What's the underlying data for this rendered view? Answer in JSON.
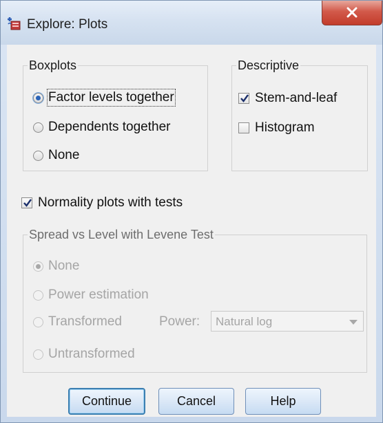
{
  "window": {
    "title": "Explore: Plots"
  },
  "boxplots": {
    "legend": "Boxplots",
    "options": [
      {
        "label": "Factor levels together",
        "selected": true
      },
      {
        "label": "Dependents together",
        "selected": false
      },
      {
        "label": "None",
        "selected": false
      }
    ]
  },
  "descriptive": {
    "legend": "Descriptive",
    "options": [
      {
        "label": "Stem-and-leaf",
        "checked": true
      },
      {
        "label": "Histogram",
        "checked": false
      }
    ]
  },
  "normality": {
    "label": "Normality plots with tests",
    "checked": true
  },
  "spread": {
    "legend": "Spread vs Level with Levene Test",
    "options": [
      {
        "label": "None",
        "selected": true
      },
      {
        "label": "Power estimation",
        "selected": false
      },
      {
        "label": "Transformed",
        "selected": false
      },
      {
        "label": "Untransformed",
        "selected": false
      }
    ],
    "power_label": "Power:",
    "power_value": "Natural log"
  },
  "buttons": {
    "continue": "Continue",
    "cancel": "Cancel",
    "help": "Help"
  }
}
